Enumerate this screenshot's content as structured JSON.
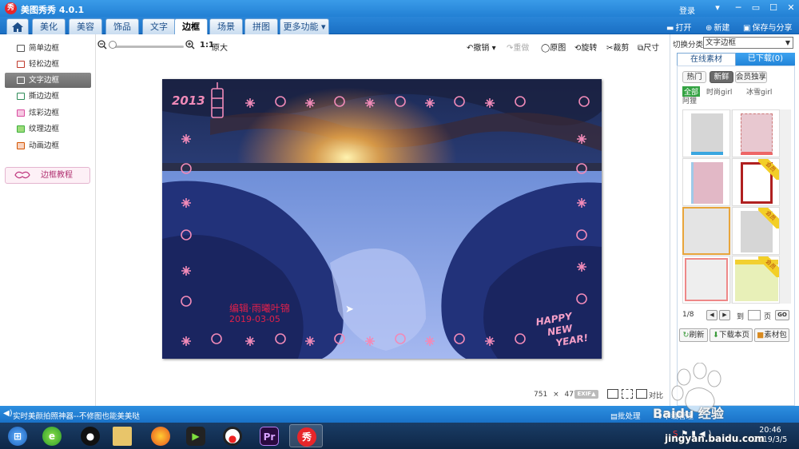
{
  "app": {
    "title": "美图秀秀 4.0.1",
    "logo_text": "秀",
    "login": "登录",
    "window_controls": [
      "─",
      "▭",
      "☐",
      "✕"
    ]
  },
  "tabs": [
    {
      "label": "美化"
    },
    {
      "label": "美容"
    },
    {
      "label": "饰品"
    },
    {
      "label": "文字"
    },
    {
      "label": "边框",
      "active": true
    },
    {
      "label": "场景"
    },
    {
      "label": "拼图"
    },
    {
      "label": "更多功能 ▾"
    }
  ],
  "top_actions": {
    "open": "打开",
    "new": "新建",
    "save": "保存与分享"
  },
  "sidebar": {
    "items": [
      {
        "label": "简单边框",
        "color": "#555555"
      },
      {
        "label": "轻松边框",
        "color": "#c0392b"
      },
      {
        "label": "文字边框",
        "active": true,
        "color": "#ffffff"
      },
      {
        "label": "撕边边框",
        "color": "#2e8b57"
      },
      {
        "label": "炫彩边框",
        "color": "#d94ca0"
      },
      {
        "label": "纹理边框",
        "color": "#3cae3c"
      },
      {
        "label": "动画边框",
        "color": "#d35400"
      }
    ],
    "tutorial": "边框教程"
  },
  "toolbar": {
    "zoom_ratio": "1:1",
    "original_size": "原大",
    "undo": "撤销",
    "redo": "重做",
    "original": "原图",
    "rotate": "旋转",
    "crop": "裁剪",
    "resize": "尺寸"
  },
  "canvas": {
    "photo_text": {
      "year": "2013",
      "signature_name": "编辑·雨曦叶锦",
      "signature_date": "2019-03-05",
      "greeting_1": "HAPPY",
      "greeting_2": "NEW",
      "greeting_3": "YEAR!"
    },
    "width": "751",
    "times": "×",
    "height": "477",
    "exif": "EXIF▲",
    "compare_label": "对比"
  },
  "right_panel": {
    "category_label": "切换分类",
    "category_value": "文字边框",
    "tabs": [
      "在线素材",
      "已下载(0)"
    ],
    "pills": [
      {
        "label": "热门"
      },
      {
        "label": "新鲜",
        "active": true
      },
      {
        "label": "会员独享"
      }
    ],
    "filters": [
      {
        "label": "全部",
        "active": true
      },
      {
        "label": "时尚girl"
      },
      {
        "label": "冰雪girl"
      },
      {
        "label": "阿狸"
      }
    ],
    "vip_label": "会员",
    "pager": {
      "page": "1/8",
      "go_to": "到",
      "page_unit": "页",
      "go": "GO"
    },
    "buttons": {
      "refresh": "刷新",
      "download_page": "下载本页",
      "material_pack": "素材包"
    }
  },
  "statusbar": {
    "tip": "实时美颜拍照神器--不修图也能美美哒",
    "batch": "批处理",
    "download_manager": "下载管理"
  },
  "taskbar": {
    "time": "20:46",
    "date": "2019/3/5",
    "apps": [
      {
        "name": "start"
      },
      {
        "name": "360-browser"
      },
      {
        "name": "qq"
      },
      {
        "name": "file-explorer"
      },
      {
        "name": "firefox"
      },
      {
        "name": "video-player"
      },
      {
        "name": "recorder"
      },
      {
        "name": "premiere",
        "text": "Pr"
      },
      {
        "name": "meitu-xiuxiu",
        "text": "秀",
        "active": true
      }
    ]
  },
  "watermark": {
    "text": "Baidu 经验",
    "url": "jingyan.baidu.com"
  }
}
